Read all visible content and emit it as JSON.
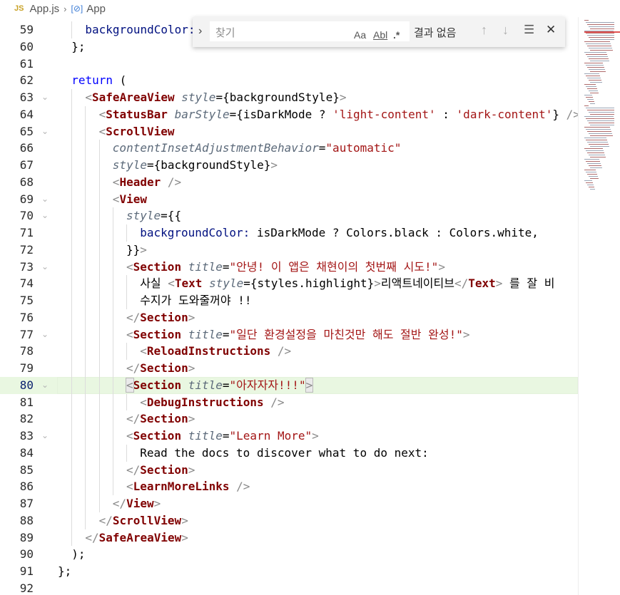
{
  "breadcrumb": {
    "file_badge": "JS",
    "file": "App.js",
    "symbol": "App"
  },
  "find": {
    "placeholder": "찾기",
    "match_case": "Aa",
    "whole_word": "Abl",
    "regex": ".*",
    "result": "결과 없음"
  },
  "editor": {
    "active_line": 80,
    "lines": [
      {
        "n": "59",
        "fold": false,
        "indent": 2,
        "tokens": [
          [
            "prop",
            "backgroundColor:"
          ]
        ]
      },
      {
        "n": "60",
        "fold": false,
        "indent": 1,
        "tokens": [
          [
            "punc",
            "};"
          ]
        ]
      },
      {
        "n": "61",
        "fold": false,
        "indent": 0,
        "tokens": []
      },
      {
        "n": "62",
        "fold": false,
        "indent": 1,
        "tokens": [
          [
            "kw",
            "return"
          ],
          [
            "punc",
            " ("
          ]
        ]
      },
      {
        "n": "63",
        "fold": true,
        "indent": 2,
        "tokens": [
          [
            "br",
            "<"
          ],
          [
            "tag",
            "SafeAreaView"
          ],
          [
            "punc",
            " "
          ],
          [
            "attr",
            "style"
          ],
          [
            "punc",
            "={backgroundStyle}"
          ],
          [
            "br",
            ">"
          ]
        ]
      },
      {
        "n": "64",
        "fold": false,
        "indent": 3,
        "tokens": [
          [
            "br",
            "<"
          ],
          [
            "tag",
            "StatusBar"
          ],
          [
            "punc",
            " "
          ],
          [
            "attr",
            "barStyle"
          ],
          [
            "punc",
            "={isDarkMode ? "
          ],
          [
            "str",
            "'light-content'"
          ],
          [
            "punc",
            " : "
          ],
          [
            "str",
            "'dark-content'"
          ],
          [
            "punc",
            "} "
          ],
          [
            "br",
            "/>"
          ]
        ]
      },
      {
        "n": "65",
        "fold": true,
        "indent": 3,
        "tokens": [
          [
            "br",
            "<"
          ],
          [
            "tag",
            "ScrollView"
          ]
        ]
      },
      {
        "n": "66",
        "fold": false,
        "indent": 4,
        "tokens": [
          [
            "attr",
            "contentInsetAdjustmentBehavior"
          ],
          [
            "punc",
            "="
          ],
          [
            "str",
            "\"automatic\""
          ]
        ]
      },
      {
        "n": "67",
        "fold": false,
        "indent": 4,
        "tokens": [
          [
            "attr",
            "style"
          ],
          [
            "punc",
            "={backgroundStyle}"
          ],
          [
            "br",
            ">"
          ]
        ]
      },
      {
        "n": "68",
        "fold": false,
        "indent": 4,
        "tokens": [
          [
            "br",
            "<"
          ],
          [
            "tag",
            "Header"
          ],
          [
            "punc",
            " "
          ],
          [
            "br",
            "/>"
          ]
        ]
      },
      {
        "n": "69",
        "fold": true,
        "indent": 4,
        "tokens": [
          [
            "br",
            "<"
          ],
          [
            "tag",
            "View"
          ]
        ]
      },
      {
        "n": "70",
        "fold": true,
        "indent": 5,
        "tokens": [
          [
            "attr",
            "style"
          ],
          [
            "punc",
            "={{"
          ]
        ]
      },
      {
        "n": "71",
        "fold": false,
        "indent": 6,
        "tokens": [
          [
            "prop",
            "backgroundColor:"
          ],
          [
            "punc",
            " isDarkMode ? Colors.black : Colors.white,"
          ]
        ]
      },
      {
        "n": "72",
        "fold": false,
        "indent": 5,
        "tokens": [
          [
            "punc",
            "}}"
          ],
          [
            "br",
            ">"
          ]
        ]
      },
      {
        "n": "73",
        "fold": true,
        "indent": 5,
        "tokens": [
          [
            "br",
            "<"
          ],
          [
            "tag",
            "Section"
          ],
          [
            "punc",
            " "
          ],
          [
            "attr",
            "title"
          ],
          [
            "punc",
            "="
          ],
          [
            "str",
            "\"안녕! 이 앱은 채현이의 첫번째 시도!\""
          ],
          [
            "br",
            ">"
          ]
        ]
      },
      {
        "n": "74",
        "fold": false,
        "indent": 6,
        "tokens": [
          [
            "text",
            "사실 "
          ],
          [
            "br",
            "<"
          ],
          [
            "tag",
            "Text"
          ],
          [
            "punc",
            " "
          ],
          [
            "attr",
            "style"
          ],
          [
            "punc",
            "={styles.highlight}"
          ],
          [
            "br",
            ">"
          ],
          [
            "text",
            "리액트네이티브"
          ],
          [
            "br",
            "</"
          ],
          [
            "tag",
            "Text"
          ],
          [
            "br",
            ">"
          ],
          [
            "text",
            " 를 잘 비"
          ]
        ]
      },
      {
        "n": "75",
        "fold": false,
        "indent": 6,
        "tokens": [
          [
            "text",
            "수지가 도와줄꺼야 !!"
          ]
        ]
      },
      {
        "n": "76",
        "fold": false,
        "indent": 5,
        "tokens": [
          [
            "br",
            "</"
          ],
          [
            "tag",
            "Section"
          ],
          [
            "br",
            ">"
          ]
        ]
      },
      {
        "n": "77",
        "fold": true,
        "indent": 5,
        "tokens": [
          [
            "br",
            "<"
          ],
          [
            "tag",
            "Section"
          ],
          [
            "punc",
            " "
          ],
          [
            "attr",
            "title"
          ],
          [
            "punc",
            "="
          ],
          [
            "str",
            "\"일단 환경설정을 마친것만 해도 절반 완성!\""
          ],
          [
            "br",
            ">"
          ]
        ]
      },
      {
        "n": "78",
        "fold": false,
        "indent": 6,
        "tokens": [
          [
            "br",
            "<"
          ],
          [
            "tag",
            "ReloadInstructions"
          ],
          [
            "punc",
            " "
          ],
          [
            "br",
            "/>"
          ]
        ]
      },
      {
        "n": "79",
        "fold": false,
        "indent": 5,
        "tokens": [
          [
            "br",
            "</"
          ],
          [
            "tag",
            "Section"
          ],
          [
            "br",
            ">"
          ]
        ]
      },
      {
        "n": "80",
        "fold": true,
        "indent": 5,
        "tokens": [
          [
            "br",
            "<"
          ],
          [
            "tag",
            "Section"
          ],
          [
            "punc",
            " "
          ],
          [
            "attr",
            "title"
          ],
          [
            "punc",
            "="
          ],
          [
            "str",
            "\"아자자자!!!\""
          ],
          [
            "br",
            ">"
          ]
        ]
      },
      {
        "n": "81",
        "fold": false,
        "indent": 6,
        "tokens": [
          [
            "br",
            "<"
          ],
          [
            "tag",
            "DebugInstructions"
          ],
          [
            "punc",
            " "
          ],
          [
            "br",
            "/>"
          ]
        ]
      },
      {
        "n": "82",
        "fold": false,
        "indent": 5,
        "tokens": [
          [
            "br",
            "</"
          ],
          [
            "tag",
            "Section"
          ],
          [
            "br",
            ">"
          ]
        ]
      },
      {
        "n": "83",
        "fold": true,
        "indent": 5,
        "tokens": [
          [
            "br",
            "<"
          ],
          [
            "tag",
            "Section"
          ],
          [
            "punc",
            " "
          ],
          [
            "attr",
            "title"
          ],
          [
            "punc",
            "="
          ],
          [
            "str",
            "\"Learn More\""
          ],
          [
            "br",
            ">"
          ]
        ]
      },
      {
        "n": "84",
        "fold": false,
        "indent": 6,
        "tokens": [
          [
            "text",
            "Read the docs to discover what to do next:"
          ]
        ]
      },
      {
        "n": "85",
        "fold": false,
        "indent": 5,
        "tokens": [
          [
            "br",
            "</"
          ],
          [
            "tag",
            "Section"
          ],
          [
            "br",
            ">"
          ]
        ]
      },
      {
        "n": "86",
        "fold": false,
        "indent": 5,
        "tokens": [
          [
            "br",
            "<"
          ],
          [
            "tag",
            "LearnMoreLinks"
          ],
          [
            "punc",
            " "
          ],
          [
            "br",
            "/>"
          ]
        ]
      },
      {
        "n": "87",
        "fold": false,
        "indent": 4,
        "tokens": [
          [
            "br",
            "</"
          ],
          [
            "tag",
            "View"
          ],
          [
            "br",
            ">"
          ]
        ]
      },
      {
        "n": "88",
        "fold": false,
        "indent": 3,
        "tokens": [
          [
            "br",
            "</"
          ],
          [
            "tag",
            "ScrollView"
          ],
          [
            "br",
            ">"
          ]
        ]
      },
      {
        "n": "89",
        "fold": false,
        "indent": 2,
        "tokens": [
          [
            "br",
            "</"
          ],
          [
            "tag",
            "SafeAreaView"
          ],
          [
            "br",
            ">"
          ]
        ]
      },
      {
        "n": "90",
        "fold": false,
        "indent": 1,
        "tokens": [
          [
            "punc",
            ");"
          ]
        ]
      },
      {
        "n": "91",
        "fold": false,
        "indent": 0,
        "tokens": [
          [
            "punc",
            "};"
          ]
        ]
      },
      {
        "n": "92",
        "fold": false,
        "indent": 0,
        "tokens": []
      }
    ]
  }
}
